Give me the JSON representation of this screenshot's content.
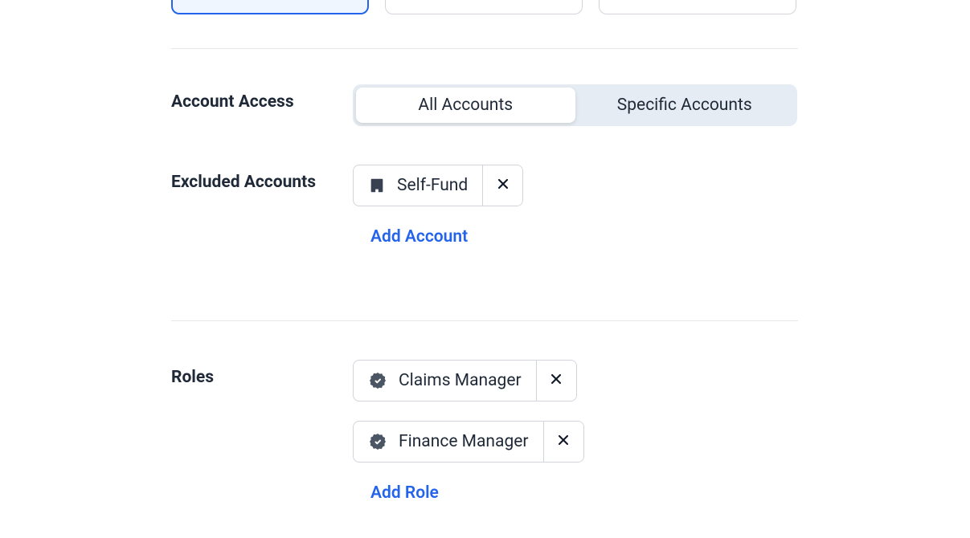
{
  "accountAccess": {
    "label": "Account Access",
    "options": {
      "all": "All Accounts",
      "specific": "Specific Accounts"
    },
    "selected": "all"
  },
  "excludedAccounts": {
    "label": "Excluded Accounts",
    "items": [
      {
        "name": "Self-Fund"
      }
    ],
    "addLabel": "Add Account"
  },
  "roles": {
    "label": "Roles",
    "items": [
      {
        "name": "Claims Manager"
      },
      {
        "name": "Finance Manager"
      }
    ],
    "addLabel": "Add Role"
  }
}
